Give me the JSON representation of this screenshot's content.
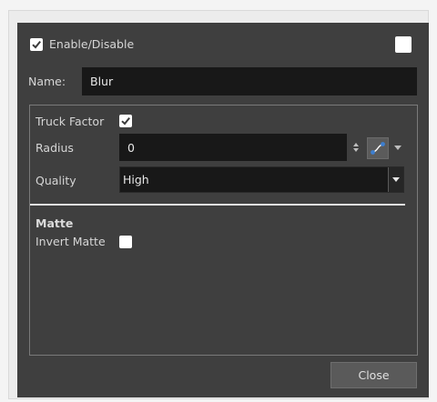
{
  "dialog": {
    "enable_label": "Enable/Disable",
    "enable_checked": true,
    "swatch_color": "#ffffff",
    "name_label": "Name:",
    "name_value": "Blur"
  },
  "params": {
    "truck_factor_label": "Truck Factor",
    "truck_factor_checked": true,
    "radius_label": "Radius",
    "radius_value": "0",
    "quality_label": "Quality",
    "quality_value": "High",
    "matte_heading": "Matte",
    "invert_matte_label": "Invert Matte",
    "invert_matte_checked": false
  },
  "footer": {
    "close_label": "Close"
  },
  "icons": {
    "spin": "up-down-arrows-icon",
    "function_curve": "function-curve-icon",
    "dropdown": "chevron-down-icon"
  },
  "colors": {
    "panel_bg": "#3f3f3f",
    "field_bg": "#181818",
    "curve_button": "#3d7fd0"
  }
}
